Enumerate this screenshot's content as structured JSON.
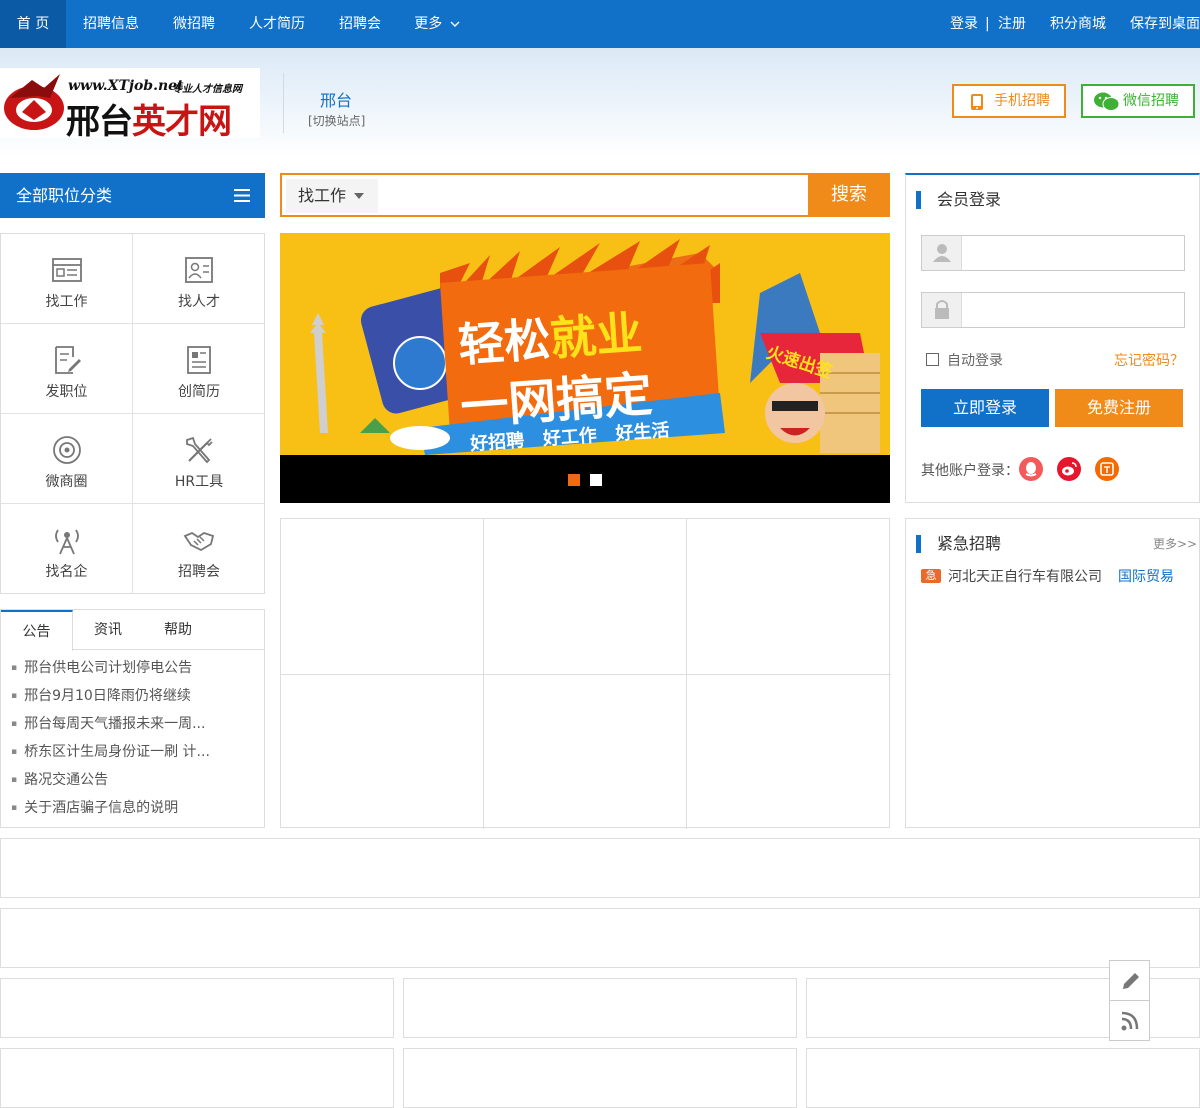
{
  "topnav": {
    "items": [
      "首 页",
      "招聘信息",
      "微招聘",
      "人才简历",
      "招聘会",
      "更多"
    ],
    "login": "登录",
    "register": "注册",
    "sep": "|",
    "points_mall": "积分商城",
    "save_desktop": "保存到桌面"
  },
  "header": {
    "logo": {
      "url": "www.XTjob.net",
      "slogan": "专业人才信息网",
      "name_a": "邢台",
      "name_b": "英才网"
    },
    "city": "邢台",
    "switch_site": "[切换站点]",
    "mobile_btn": "手机招聘",
    "wechat_btn": "微信招聘"
  },
  "category": {
    "title": "全部职位分类",
    "items": [
      "找工作",
      "找人才",
      "发职位",
      "创简历",
      "微商圈",
      "HR工具",
      "找名企",
      "招聘会"
    ]
  },
  "tabs": {
    "labels": [
      "公告",
      "资讯",
      "帮助"
    ],
    "notices": [
      "邢台供电公司计划停电公告",
      "邢台9月10日降雨仍将继续",
      "邢台每周天气播报未来一周...",
      "桥东区计生局身份证一刷 计...",
      "路况交通公告",
      "关于酒店骗子信息的说明"
    ]
  },
  "search": {
    "type": "找工作",
    "placeholder": "",
    "button": "搜索"
  },
  "banner": {
    "line1a": "轻松",
    "line1b": "就业",
    "line2": "一网搞定",
    "tagline": "好招聘   好工作   好生活",
    "flag": "火速出签"
  },
  "login": {
    "title": "会员登录",
    "username_placeholder": "",
    "password_placeholder": "",
    "auto_login": "自动登录",
    "forgot": "忘记密码？",
    "login_btn": "立即登录",
    "register_btn": "免费注册",
    "other_login": "其他账户登录：",
    "social_icons": [
      "qq-icon",
      "weibo-icon",
      "taobao-icon"
    ]
  },
  "urgent": {
    "title": "紧急招聘",
    "more": "更多>>",
    "badge": "急",
    "company": "河北天正自行车有限公司",
    "industry": "国际贸易"
  },
  "colors": {
    "primary": "#1170c8",
    "accent": "#f08a19",
    "wechat": "#3eb135"
  }
}
